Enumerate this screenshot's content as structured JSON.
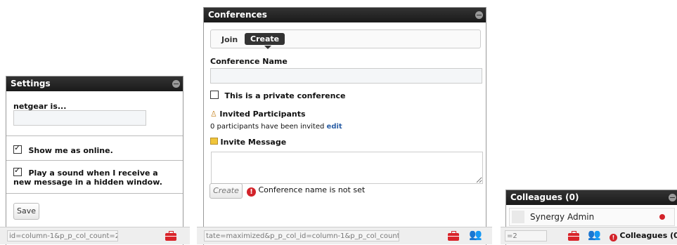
{
  "settings": {
    "title": "Settings",
    "user_label": "netgear is...",
    "status_value": "",
    "show_online_label": "Show me as online.",
    "play_sound_label": "Play a sound when I receive a new message in a hidden window.",
    "save_label": "Save",
    "url_fragment": "id=column-1&p_p_col_count=2"
  },
  "conferences": {
    "title": "Conferences",
    "tabs": {
      "join": "Join",
      "create": "Create"
    },
    "name_label": "Conference Name",
    "name_value": "",
    "private_label": "This is a private conference",
    "invited_label": "Invited Participants",
    "invited_count_text": "0 participants have been invited",
    "edit_link": "edit",
    "invite_message_label": "Invite Message",
    "invite_message_value": "",
    "create_button": "Create",
    "error_text": "Conference name is not set",
    "url_fragment": "tate=maximized&p_p_col_id=column-1&p_p_col_count=2"
  },
  "colleagues": {
    "title": "Colleagues (0)",
    "items": [
      {
        "name": "Synergy Admin",
        "status_color": "#d3232a"
      }
    ],
    "footer_label": "Colleagues (0)",
    "url_fragment": "=2"
  }
}
